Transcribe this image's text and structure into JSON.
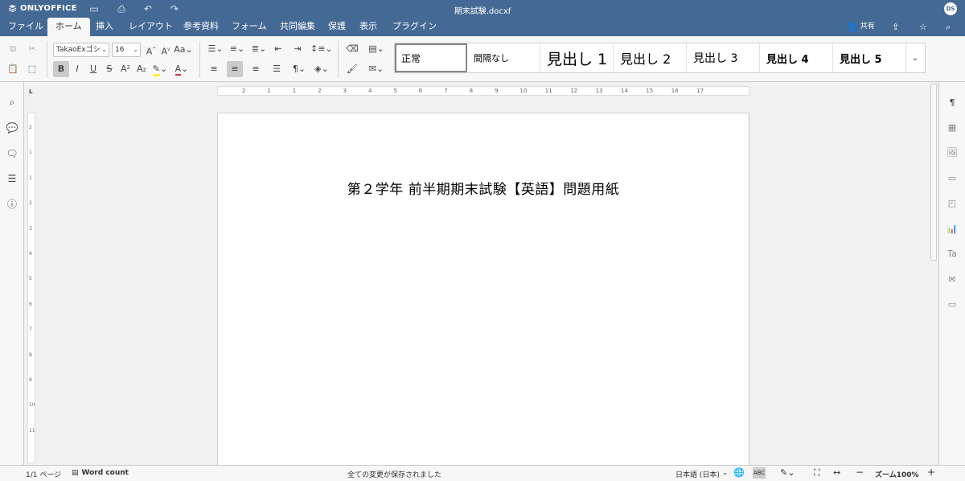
{
  "app": {
    "logo_text": "ONLYOFFICE",
    "document_title": "期末試験.docxf",
    "user_initials": "DS"
  },
  "menu": {
    "tabs": [
      "ファイル",
      "ホーム",
      "挿入",
      "レイアウト",
      "参考資料",
      "フォーム",
      "共同編集",
      "保護",
      "表示",
      "プラグイン"
    ],
    "active_tab": "ホーム",
    "share_label": "共有"
  },
  "toolbar": {
    "font_name": "TakaoExゴシ",
    "font_size": "16",
    "styles": [
      "正常",
      "間隔なし",
      "見出し 1",
      "見出し 2",
      "見出し 3",
      "見出し 4",
      "見出し 5"
    ],
    "selected_style": "正常"
  },
  "document": {
    "heading": "第２学年 前半期期末試験【英語】問題用紙"
  },
  "ruler": {
    "h_labels": [
      "2",
      "1",
      "1",
      "2",
      "3",
      "4",
      "5",
      "6",
      "7",
      "8",
      "9",
      "10",
      "11",
      "12",
      "13",
      "14",
      "15",
      "16",
      "17"
    ],
    "v_labels": [
      "2",
      "1",
      "1",
      "2",
      "3",
      "4",
      "5",
      "6",
      "7",
      "8",
      "9",
      "10",
      "11"
    ]
  },
  "status": {
    "page_info": "1/1 ページ",
    "word_count": "Word count",
    "save_status": "全ての変更が保存されました",
    "language": "日本語 (日本)",
    "zoom": "ズーム100%"
  },
  "colors": {
    "header_bg": "#446995",
    "toolbar_bg": "#f7f7f7"
  }
}
